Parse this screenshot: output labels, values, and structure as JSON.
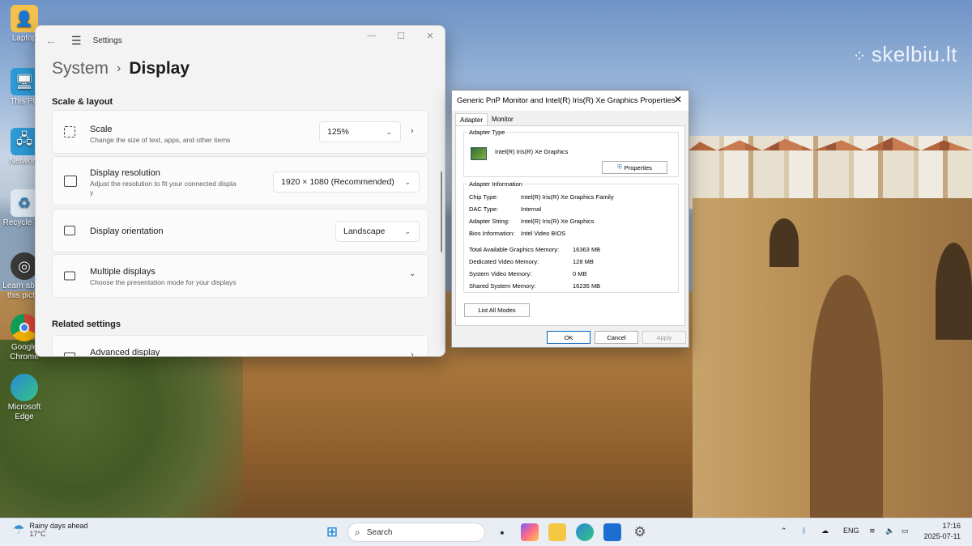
{
  "watermark": "skelbiu.lt",
  "desktop_icons": [
    {
      "label": "Laptop",
      "icon": "folder-user-icon"
    },
    {
      "label": "This PC",
      "icon": "monitor-icon"
    },
    {
      "label": "Network",
      "icon": "network-icon"
    },
    {
      "label": "Recycle Bin",
      "icon": "recycle-bin-icon"
    },
    {
      "label": "Learn about this pict...",
      "icon": "camera-info-icon"
    },
    {
      "label": "Google Chrome",
      "icon": "chrome-icon"
    },
    {
      "label": "Microsoft Edge",
      "icon": "edge-icon"
    }
  ],
  "settings": {
    "window_title": "Settings",
    "breadcrumb_parent": "System",
    "breadcrumb_separator": "›",
    "breadcrumb_current": "Display",
    "section_scale_layout": "Scale & layout",
    "scale": {
      "title": "Scale",
      "description": "Change the size of text, apps, and other items",
      "value": "125%"
    },
    "resolution": {
      "title": "Display resolution",
      "description_line1": "Adjust the resolution to fit your connected displa",
      "description_line2": "y",
      "value": "1920 × 1080 (Recommended)"
    },
    "orientation": {
      "title": "Display orientation",
      "value": "Landscape"
    },
    "multiple": {
      "title": "Multiple displays",
      "description": "Choose the presentation mode for your displays"
    },
    "section_related": "Related settings",
    "advanced": {
      "title": "Advanced display"
    }
  },
  "props": {
    "title": "Generic PnP Monitor and Intel(R) Iris(R) Xe Graphics Properties",
    "tabs": [
      "Adapter",
      "Monitor"
    ],
    "adapter_type_legend": "Adapter Type",
    "adapter_name": "Intel(R) Iris(R) Xe Graphics",
    "properties_button": "Properties",
    "adapter_info_legend": "Adapter Information",
    "info": [
      {
        "label": "Chip Type:",
        "value": "Intel(R) Iris(R) Xe Graphics Family"
      },
      {
        "label": "DAC Type:",
        "value": "Internal"
      },
      {
        "label": "Adapter String:",
        "value": "Intel(R) Iris(R) Xe Graphics"
      },
      {
        "label": "Bios Information:",
        "value": "Intel Video BIOS"
      }
    ],
    "memory": [
      {
        "label": "Total Available Graphics Memory:",
        "value": "16363 MB"
      },
      {
        "label": "Dedicated Video Memory:",
        "value": "128 MB"
      },
      {
        "label": "System Video Memory:",
        "value": "0 MB"
      },
      {
        "label": "Shared System Memory:",
        "value": "16235 MB"
      }
    ],
    "list_modes_button": "List All Modes",
    "ok_button": "OK",
    "cancel_button": "Cancel",
    "apply_button": "Apply"
  },
  "taskbar": {
    "weather_title": "Rainy days ahead",
    "weather_temp": "17°C",
    "search_placeholder": "Search",
    "language": "ENG",
    "time": "17:16",
    "date": "2025-07-11"
  },
  "colors": {
    "accent": "#0067c0",
    "settings_bg": "#f3f3f3",
    "taskbar_bg": "#e9eef4"
  }
}
